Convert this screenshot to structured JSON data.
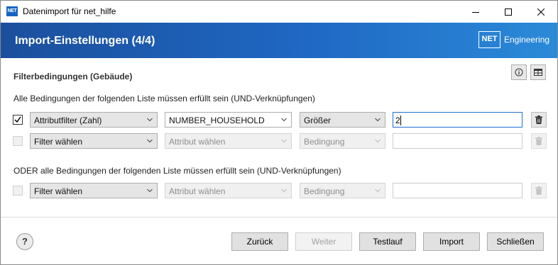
{
  "window": {
    "icon_text": "NET",
    "title": "Datenimport für net_hilfe"
  },
  "banner": {
    "title": "Import-Einstellungen (4/4)",
    "logo_box": "NET",
    "logo_text": "Engineering"
  },
  "filter_section": {
    "title": "Filterbedingungen (Gebäude)",
    "and_group_label": "Alle Bedingungen der folgenden Liste müssen erfüllt sein (UND-Verknüpfungen)",
    "or_group_label": "ODER alle Bedingungen der folgenden Liste müssen erfüllt sein (UND-Verknüpfungen)",
    "and_rows": [
      {
        "checked": true,
        "filter": "Attributfilter (Zahl)",
        "attribute": "NUMBER_HOUSEHOLD",
        "condition": "Größer",
        "value": "2",
        "enabled": true
      },
      {
        "checked": false,
        "filter": "Filter wählen",
        "attribute": "Attribut wählen",
        "condition": "Bedingung",
        "value": "",
        "enabled": false
      }
    ],
    "or_rows": [
      {
        "checked": false,
        "filter": "Filter wählen",
        "attribute": "Attribut wählen",
        "condition": "Bedingung",
        "value": "",
        "enabled": false
      }
    ]
  },
  "footer": {
    "help_label": "?",
    "back_label": "Zurück",
    "next_label": "Weiter",
    "test_label": "Testlauf",
    "import_label": "Import",
    "close_label": "Schließen"
  },
  "colors": {
    "banner_start": "#1b4f9c",
    "banner_end": "#2b8ad8",
    "focus_border": "#1e6fd0"
  },
  "icons": [
    "minimize-icon",
    "maximize-icon",
    "close-icon",
    "info-icon",
    "table-icon",
    "checkmark-icon",
    "chevron-down-icon",
    "trash-icon"
  ]
}
